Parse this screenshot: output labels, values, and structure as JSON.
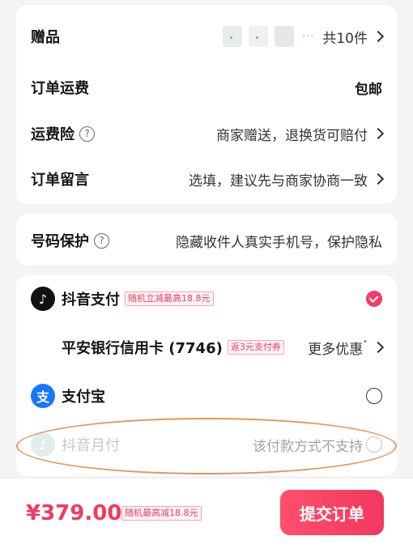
{
  "order": {
    "gift": {
      "label": "赠品",
      "count": "共10件"
    },
    "shipping": {
      "label": "订单运费",
      "value": "包邮"
    },
    "insurance": {
      "label": "运费险",
      "value": "商家赠送，退换货可赔付"
    },
    "note": {
      "label": "订单留言",
      "placeholder": "选填，建议先与商家协商一致"
    }
  },
  "privacy": {
    "label": "号码保护",
    "value": "隐藏收件人真实手机号，保护隐私"
  },
  "payment": {
    "douyin_pay": {
      "label": "抖音支付",
      "promo": "随机立减最高18.8元"
    },
    "bank_card": {
      "label": "平安银行信用卡 (7746)",
      "promo": "返3元支付券",
      "more": "更多优惠"
    },
    "alipay": {
      "label": "支付宝"
    },
    "douyin_monthly": {
      "label": "抖音月付",
      "status": "该付款方式不支持"
    }
  },
  "footer": {
    "price": "¥379.00",
    "promo": "随机最高减18.8元",
    "submit": "提交订单"
  },
  "colors": {
    "accent": "#f23c64",
    "alipay": "#1677ff",
    "douyin_logo": "#111111",
    "highlight_ellipse": "#e1975a"
  }
}
